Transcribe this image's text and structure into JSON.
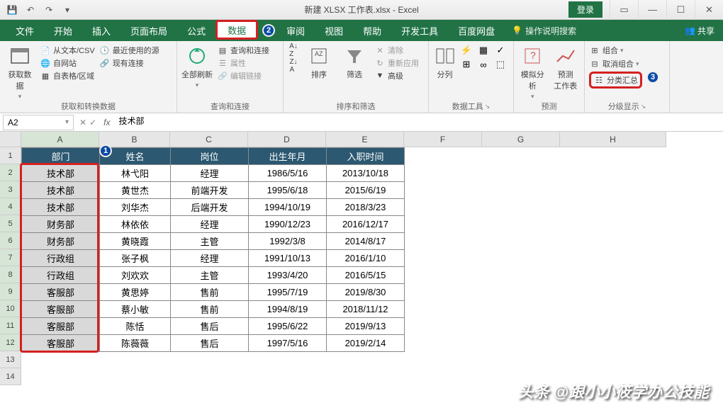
{
  "title": "新建 XLSX 工作表.xlsx - Excel",
  "login_label": "登录",
  "share_label": "共享",
  "tabs": [
    "文件",
    "开始",
    "插入",
    "页面布局",
    "公式",
    "数据",
    "审阅",
    "视图",
    "帮助",
    "开发工具",
    "百度网盘"
  ],
  "active_tab": "数据",
  "tell_me": "操作说明搜索",
  "ribbon": {
    "g1": {
      "label": "获取和转换数据",
      "big": "获取数\n据",
      "items": [
        "从文本/CSV",
        "自网站",
        "自表格/区域",
        "最近使用的源",
        "现有连接"
      ]
    },
    "g2": {
      "label": "查询和连接",
      "big": "全部刷新",
      "items": [
        "查询和连接",
        "属性",
        "编辑链接"
      ]
    },
    "g3": {
      "label": "排序和筛选",
      "sort": "排序",
      "filter": "筛选",
      "items": [
        "清除",
        "重新应用",
        "高级"
      ]
    },
    "g4": {
      "label": "数据工具",
      "split": "分列"
    },
    "g5": {
      "label": "预测",
      "sim": "模拟分析",
      "forecast": "预测\n工作表"
    },
    "g6": {
      "label": "分级显示",
      "items": [
        "组合",
        "取消组合",
        "分类汇总"
      ]
    }
  },
  "namebox": "A2",
  "formula": "技术部",
  "cols": {
    "A": 110,
    "B": 100,
    "C": 110,
    "D": 110,
    "E": 110,
    "F": 110,
    "G": 110,
    "H": 150
  },
  "headers": [
    "部门",
    "姓名",
    "岗位",
    "出生年月",
    "入职时间"
  ],
  "rows": [
    [
      "技术部",
      "林弋阳",
      "经理",
      "1986/5/16",
      "2013/10/18"
    ],
    [
      "技术部",
      "黄世杰",
      "前端开发",
      "1995/6/18",
      "2015/6/19"
    ],
    [
      "技术部",
      "刘华杰",
      "后端开发",
      "1994/10/19",
      "2018/3/23"
    ],
    [
      "财务部",
      "林依依",
      "经理",
      "1990/12/23",
      "2016/12/17"
    ],
    [
      "财务部",
      "黄晓霞",
      "主管",
      "1992/3/8",
      "2014/8/17"
    ],
    [
      "行政组",
      "张子枫",
      "经理",
      "1991/10/13",
      "2016/1/10"
    ],
    [
      "行政组",
      "刘欢欢",
      "主管",
      "1993/4/20",
      "2016/5/15"
    ],
    [
      "客服部",
      "黄思婷",
      "售前",
      "1995/7/19",
      "2019/8/30"
    ],
    [
      "客服部",
      "蔡小敏",
      "售前",
      "1994/8/19",
      "2018/11/12"
    ],
    [
      "客服部",
      "陈恬",
      "售后",
      "1995/6/22",
      "2019/9/13"
    ],
    [
      "客服部",
      "陈薇薇",
      "售后",
      "1997/5/16",
      "2019/2/14"
    ]
  ],
  "watermark": "头条 @跟小小筱学办公技能"
}
